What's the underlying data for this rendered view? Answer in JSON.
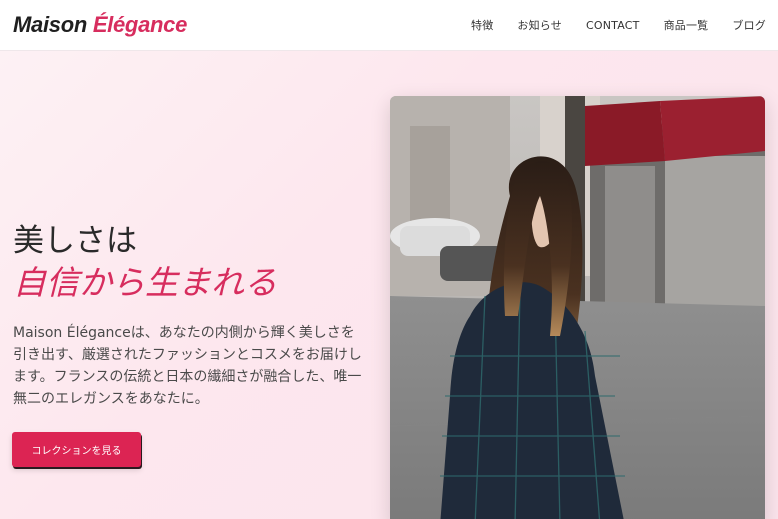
{
  "header": {
    "logo_part1": "Maison",
    "logo_part2": "Élégance",
    "nav": [
      {
        "label": "特徴"
      },
      {
        "label": "お知らせ"
      },
      {
        "label": "CONTACT"
      },
      {
        "label": "商品一覧"
      },
      {
        "label": "ブログ"
      }
    ]
  },
  "hero": {
    "headline_line1": "美しさは",
    "headline_line2": "自信から生まれる",
    "description": "Maison Éléganceは、あなたの内側から輝く美しさを引き出す、厳選されたファッションとコスメをお届けします。フランスの伝統と日本の繊細さが融合した、唯一無二のエレガンスをあなたに。",
    "cta_label": "コレクションを見る"
  },
  "colors": {
    "accent": "#d72d5e",
    "button": "#dc2453",
    "hero_background": "#fde7ee"
  }
}
